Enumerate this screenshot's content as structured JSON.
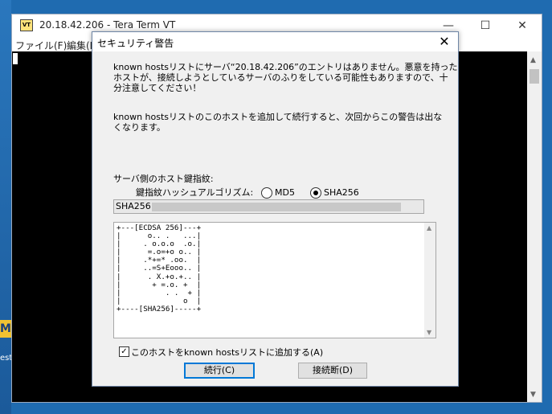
{
  "desktop": {
    "icon_glyph": "M",
    "label": "est"
  },
  "terminal": {
    "title": "20.18.42.206 - Tera Term VT",
    "logo": "VT",
    "menu": [
      "ファイル(F)",
      "編集(E)"
    ],
    "window_buttons": [
      "—",
      "☐",
      "✕"
    ]
  },
  "dialog": {
    "title": "セキュリティ警告",
    "close": "✕",
    "warning_line1": "known hostsリストにサーバ“20.18.42.206”のエントリはありません。悪意を持った",
    "warning_line2": "ホストが、接続しようとしているサーバのふりをしている可能性もありますので、十",
    "warning_line3": "分注意してください！",
    "info_line1": "known hostsリストのこのホストを追加して続行すると、次回からこの警告は出な",
    "info_line2": "くなります。",
    "fingerprint_label": "サーバ側のホスト鍵指紋:",
    "hash_algo_label": "鍵指紋ハッシュアルゴリズム:",
    "radio_md5": "MD5",
    "radio_sha256": "SHA256",
    "selected_algo": "SHA256",
    "fingerprint_value": "SHA256:",
    "randomart": "+---[ECDSA 256]---+\n|      o.. .   ...|\n|     . o.o.o  .o.|\n|      =.o=+o o.. |\n|     .*+=* .oo.  |\n|     ..=S+Eooo.. |\n|      . X.+o.+.. |\n|       + =.o. +  |\n|          . .  + |\n|              o  |\n+----[SHA256]-----+",
    "checkbox_label": "このホストをknown hostsリストに追加する(A)",
    "checkbox_checked": "✓",
    "continue_button": "続行(C)",
    "disconnect_button": "接続断(D)"
  }
}
